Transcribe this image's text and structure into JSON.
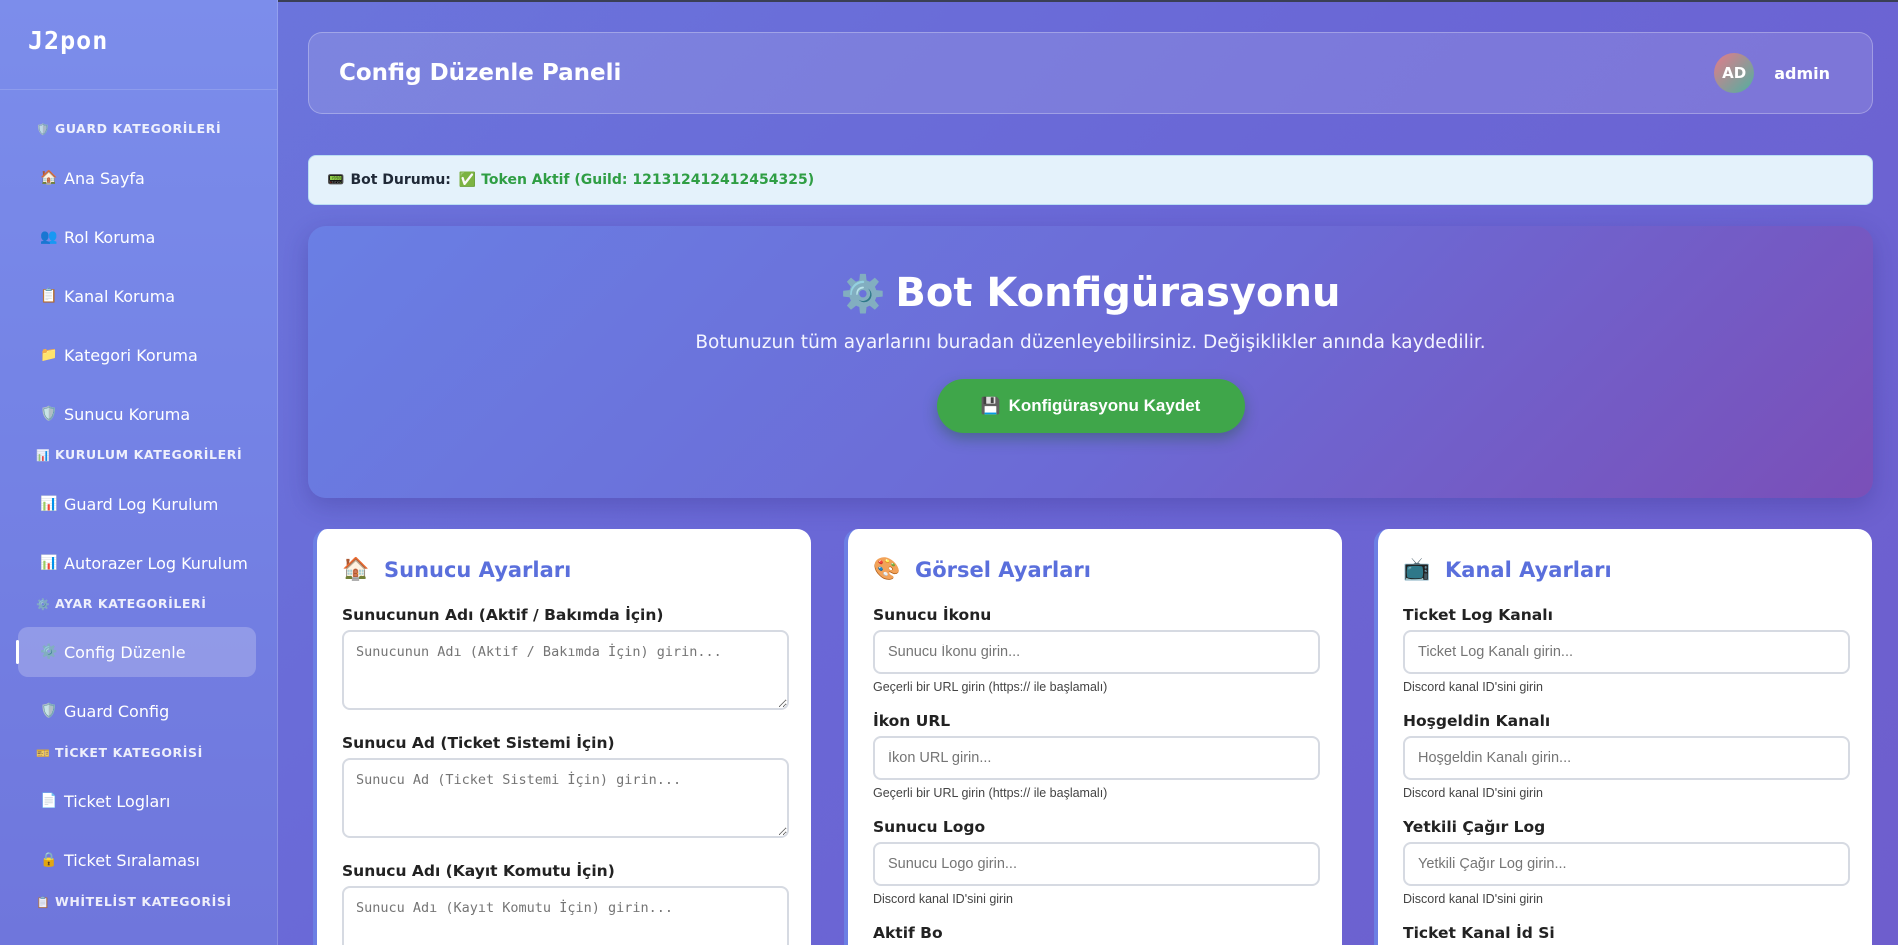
{
  "brand": "J2pon",
  "sidebar": {
    "categories": [
      {
        "icon": "🛡️",
        "label": "GUARD KATEGORİLERİ"
      },
      {
        "icon": "📊",
        "label": "KURULUM KATEGORİLERİ"
      },
      {
        "icon": "⚙️",
        "label": "AYAR KATEGORİLERİ"
      },
      {
        "icon": "🎫",
        "label": "TİCKET KATEGORİSİ"
      },
      {
        "icon": "📋",
        "label": "WHİTELİST KATEGORİSİ"
      }
    ],
    "items": [
      {
        "icon": "🏠",
        "label": "Ana Sayfa"
      },
      {
        "icon": "👥",
        "label": "Rol Koruma"
      },
      {
        "icon": "📋",
        "label": "Kanal Koruma"
      },
      {
        "icon": "📁",
        "label": "Kategori Koruma"
      },
      {
        "icon": "🛡️",
        "label": "Sunucu Koruma"
      },
      {
        "icon": "📊",
        "label": "Guard Log Kurulum"
      },
      {
        "icon": "📊",
        "label": "Autorazer Log Kurulum"
      },
      {
        "icon": "⚙️",
        "label": "Config Düzenle"
      },
      {
        "icon": "🛡️",
        "label": "Guard Config"
      },
      {
        "icon": "📄",
        "label": "Ticket Logları"
      },
      {
        "icon": "🔒",
        "label": "Ticket Sıralaması"
      }
    ]
  },
  "header": {
    "title": "Config Düzenle Paneli",
    "avatar_initials": "AD",
    "username": "admin"
  },
  "status": {
    "icon": "📟",
    "label": "Bot Durumu:",
    "check_icon": "✅",
    "value": "Token Aktif (Guild: 121312412412454325)"
  },
  "hero": {
    "icon": "⚙️",
    "title": "Bot Konfigürasyonu",
    "subtitle": "Botunuzun tüm ayarlarını buradan düzenleyebilirsiniz. Değişiklikler anında kaydedilir.",
    "save_icon": "💾",
    "save_label": "Konfigürasyonu Kaydet"
  },
  "cards": {
    "server": {
      "icon": "🏠",
      "title": "Sunucu Ayarları",
      "fields": [
        {
          "label": "Sunucunun Adı (Aktif / Bakımda İçin)",
          "placeholder": "Sunucunun Adı (Aktif / Bakımda İçin) girin..."
        },
        {
          "label": "Sunucu Ad (Ticket Sistemi İçin)",
          "placeholder": "Sunucu Ad (Ticket Sistemi İçin) girin..."
        },
        {
          "label": "Sunucu Adı (Kayıt Komutu İçin)",
          "placeholder": "Sunucu Adı (Kayıt Komutu İçin) girin..."
        }
      ]
    },
    "visual": {
      "icon": "🎨",
      "title": "Görsel Ayarları",
      "fields": [
        {
          "label": "Sunucu İkonu",
          "placeholder": "Sunucu İkonu girin...",
          "hint": "Geçerli bir URL girin (https:// ile başlamalı)"
        },
        {
          "label": "İkon URL",
          "placeholder": "İkon URL girin...",
          "hint": "Geçerli bir URL girin (https:// ile başlamalı)"
        },
        {
          "label": "Sunucu Logo",
          "placeholder": "Sunucu Logo girin...",
          "hint": "Discord kanal ID'sini girin"
        },
        {
          "label": "Aktif Bo"
        }
      ]
    },
    "channel": {
      "icon": "📺",
      "title": "Kanal Ayarları",
      "fields": [
        {
          "label": "Ticket Log Kanalı",
          "placeholder": "Ticket Log Kanalı girin...",
          "hint": "Discord kanal ID'sini girin"
        },
        {
          "label": "Hoşgeldin Kanalı",
          "placeholder": "Hoşgeldin Kanalı girin...",
          "hint": "Discord kanal ID'sini girin"
        },
        {
          "label": "Yetkili Çağır Log",
          "placeholder": "Yetkili Çağır Log girin...",
          "hint": "Discord kanal ID'sini girin"
        },
        {
          "label": "Ticket Kanal İd Si"
        }
      ]
    }
  }
}
